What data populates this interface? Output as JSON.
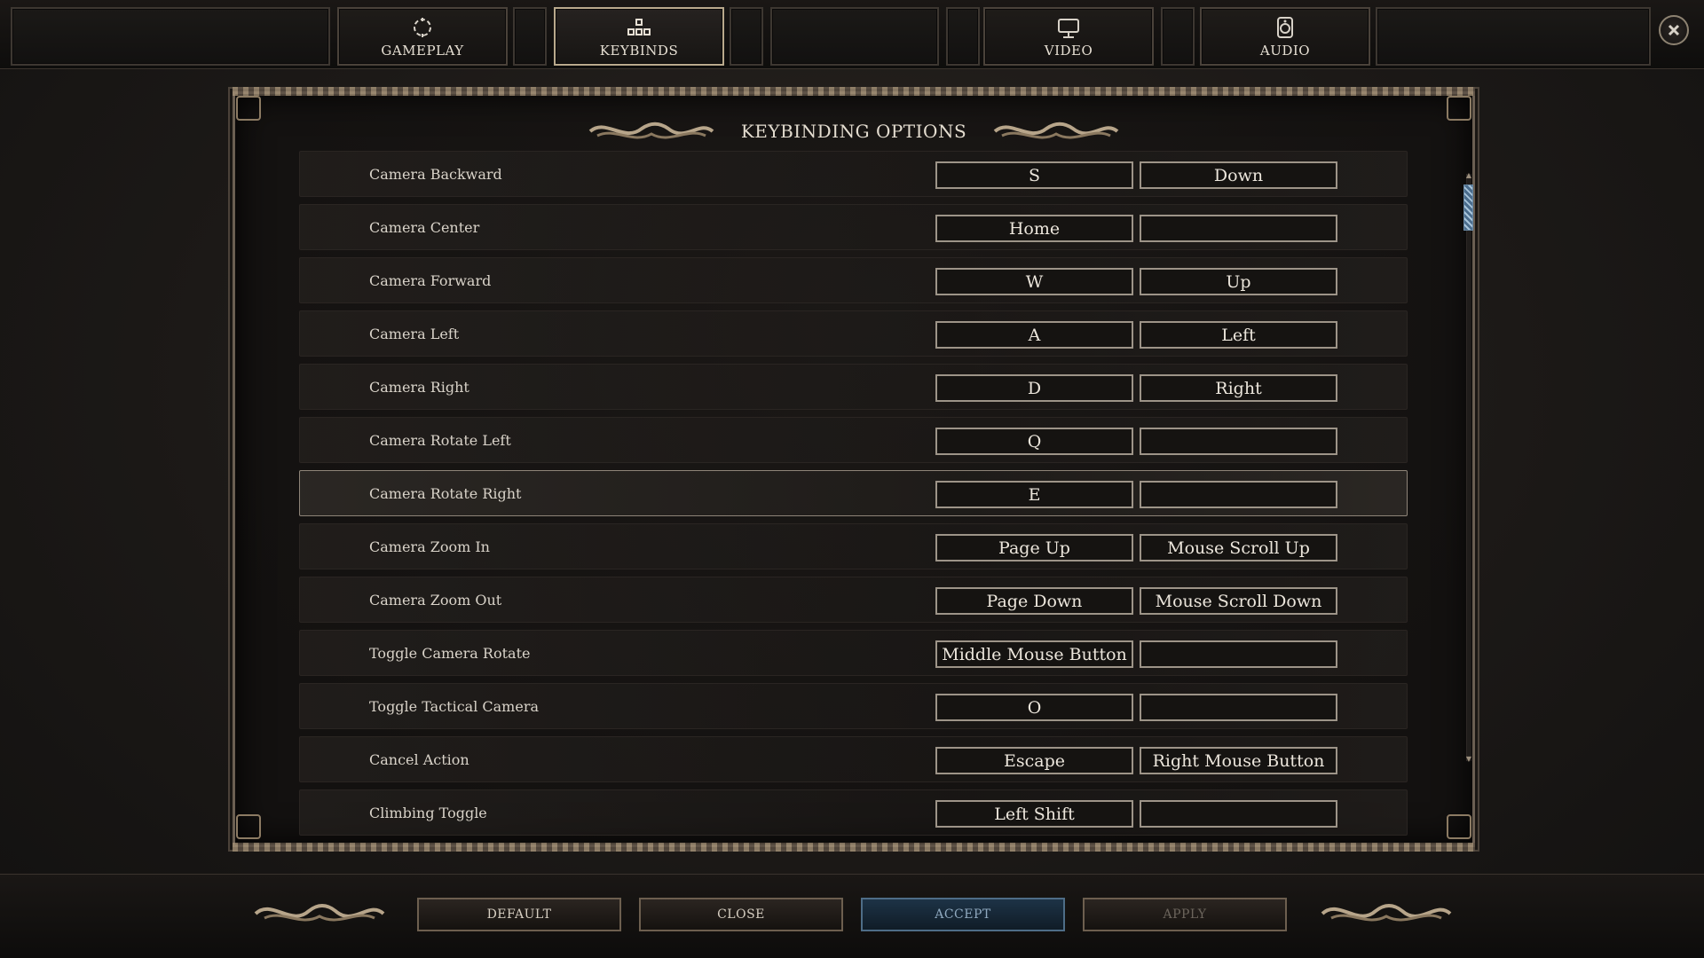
{
  "tabs": [
    {
      "label": "GAMEPLAY",
      "icon": "gameplay-icon",
      "active": false
    },
    {
      "label": "KEYBINDS",
      "icon": "keybinds-icon",
      "active": true
    },
    {
      "label": "VIDEO",
      "icon": "monitor-icon",
      "active": false
    },
    {
      "label": "AUDIO",
      "icon": "speaker-icon",
      "active": false
    }
  ],
  "panel": {
    "title": "KEYBINDING OPTIONS"
  },
  "bindings": [
    {
      "action": "Camera Backward",
      "primary": "S",
      "secondary": "Down"
    },
    {
      "action": "Camera Center",
      "primary": "Home",
      "secondary": ""
    },
    {
      "action": "Camera Forward",
      "primary": "W",
      "secondary": "Up"
    },
    {
      "action": "Camera Left",
      "primary": "A",
      "secondary": "Left"
    },
    {
      "action": "Camera Right",
      "primary": "D",
      "secondary": "Right"
    },
    {
      "action": "Camera Rotate Left",
      "primary": "Q",
      "secondary": ""
    },
    {
      "action": "Camera Rotate Right",
      "primary": "E",
      "secondary": "",
      "selected": true
    },
    {
      "action": "Camera Zoom In",
      "primary": "Page Up",
      "secondary": "Mouse Scroll Up"
    },
    {
      "action": "Camera Zoom Out",
      "primary": "Page Down",
      "secondary": "Mouse Scroll Down"
    },
    {
      "action": "Toggle Camera Rotate",
      "primary": "Middle Mouse Button",
      "secondary": ""
    },
    {
      "action": "Toggle Tactical Camera",
      "primary": "O",
      "secondary": ""
    },
    {
      "action": "Cancel Action",
      "primary": "Escape",
      "secondary": "Right Mouse Button"
    },
    {
      "action": "Climbing Toggle",
      "primary": "Left Shift",
      "secondary": ""
    }
  ],
  "footer": {
    "default_label": "DEFAULT",
    "close_label": "CLOSE",
    "accept_label": "ACCEPT",
    "apply_label": "APPLY"
  },
  "colors": {
    "accent_blue": "#4e6d87",
    "frame_gold": "#8c7b63",
    "background": "#1c1917"
  }
}
